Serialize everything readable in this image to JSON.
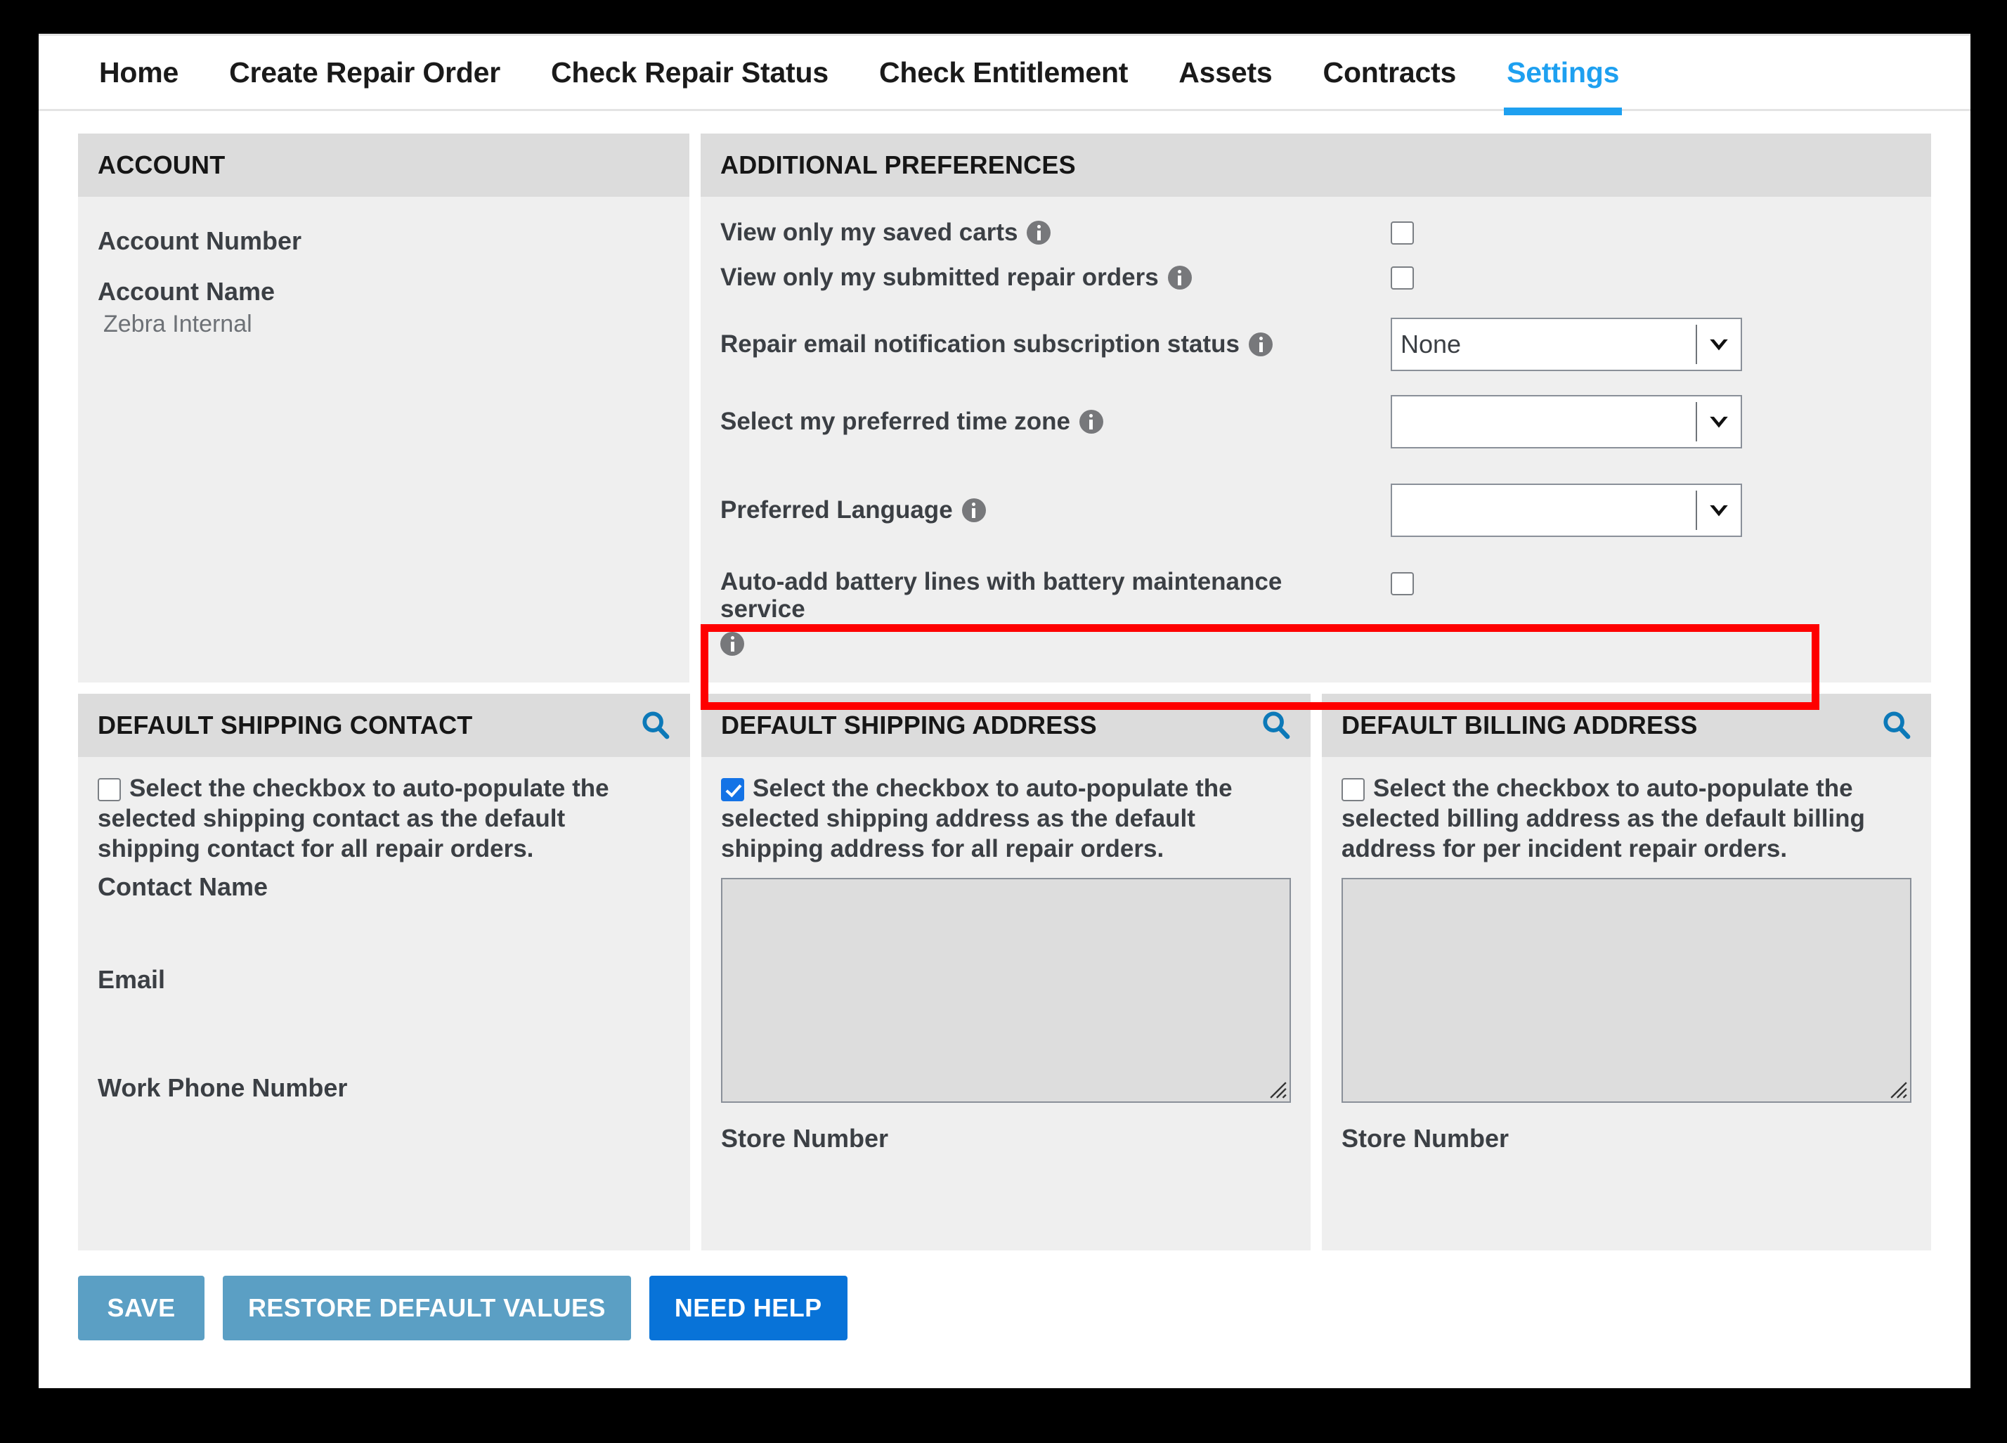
{
  "nav": {
    "items": [
      {
        "label": "Home",
        "active": false
      },
      {
        "label": "Create Repair Order",
        "active": false
      },
      {
        "label": "Check Repair Status",
        "active": false
      },
      {
        "label": "Check Entitlement",
        "active": false
      },
      {
        "label": "Assets",
        "active": false
      },
      {
        "label": "Contracts",
        "active": false
      },
      {
        "label": "Settings",
        "active": true
      }
    ],
    "active_color": "#1ea0f0"
  },
  "account": {
    "title": "ACCOUNT",
    "account_number_label": "Account Number",
    "account_number_value": "",
    "account_name_label": "Account Name",
    "account_name_value": "Zebra Internal"
  },
  "preferences": {
    "title": "ADDITIONAL PREFERENCES",
    "rows": [
      {
        "label": "View only my saved carts",
        "type": "checkbox",
        "checked": false
      },
      {
        "label": "View only my submitted repair orders",
        "type": "checkbox",
        "checked": false
      },
      {
        "label": "Repair email notification subscription status",
        "type": "select",
        "value": "None"
      },
      {
        "label": "Select my preferred time zone",
        "type": "select",
        "value": ""
      },
      {
        "label": "Preferred Language",
        "type": "select",
        "value": "",
        "highlighted": true
      },
      {
        "label": "Auto-add battery lines with battery maintenance service",
        "type": "checkbox",
        "checked": false
      }
    ],
    "highlight_color": "#fe0000"
  },
  "shipping_contact": {
    "title": "DEFAULT SHIPPING CONTACT",
    "search_icon": "search-icon",
    "checkbox_checked": false,
    "checkbox_note": "Select the checkbox to auto-populate the selected shipping contact as the default shipping contact for all repair orders.",
    "contact_name_label": "Contact Name",
    "contact_name_value": "",
    "email_label": "Email",
    "email_value": "",
    "work_phone_label": "Work Phone Number",
    "work_phone_value": ""
  },
  "shipping_address": {
    "title": "DEFAULT SHIPPING ADDRESS",
    "search_icon": "search-icon",
    "checkbox_checked": true,
    "checkbox_note": "Select the checkbox to auto-populate the selected shipping address as the default shipping address for all repair orders.",
    "address_value": "",
    "store_number_label": "Store Number",
    "store_number_value": ""
  },
  "billing_address": {
    "title": "DEFAULT BILLING ADDRESS",
    "search_icon": "search-icon",
    "checkbox_checked": false,
    "checkbox_note": "Select the checkbox to auto-populate the selected billing address as the default billing address for per incident repair orders.",
    "address_value": "",
    "store_number_label": "Store Number",
    "store_number_value": ""
  },
  "footer": {
    "save_label": "SAVE",
    "restore_label": "RESTORE DEFAULT VALUES",
    "help_label": "NEED HELP"
  }
}
